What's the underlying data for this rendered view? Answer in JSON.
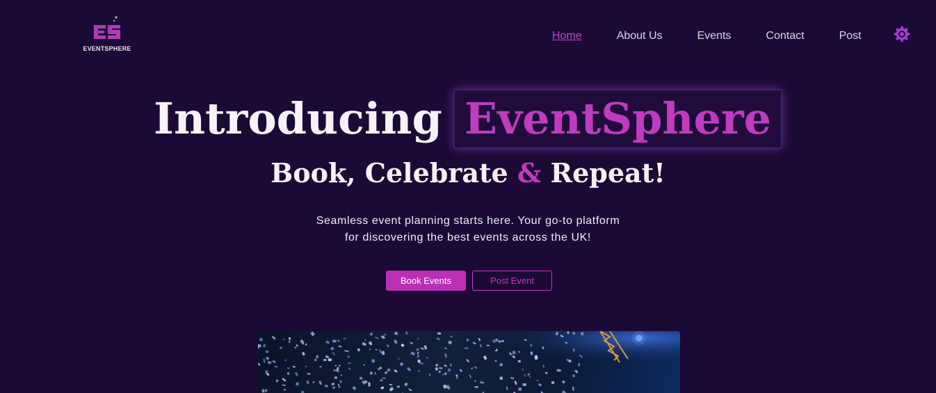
{
  "brand": {
    "logo_text": "EVENTSPHERE",
    "accent_color": "#c03bbd",
    "background_color": "#1b0a36"
  },
  "nav": {
    "items": [
      {
        "label": "Home",
        "active": true
      },
      {
        "label": "About Us",
        "active": false
      },
      {
        "label": "Events",
        "active": false
      },
      {
        "label": "Contact",
        "active": false
      },
      {
        "label": "Post",
        "active": false
      }
    ],
    "settings_icon": "gear-icon"
  },
  "hero": {
    "title_prefix": "Introducing",
    "title_brand": "EventSphere",
    "subtitle_part1": "Book, Celebrate",
    "subtitle_amp": "&",
    "subtitle_part2": "Repeat!",
    "description_line1": "Seamless event planning starts here. Your go-to platform",
    "description_line2": "for discovering the best events across the UK!",
    "primary_button": "Book Events",
    "secondary_button": "Post Event"
  },
  "image": {
    "icon": "concert-confetti-image"
  }
}
